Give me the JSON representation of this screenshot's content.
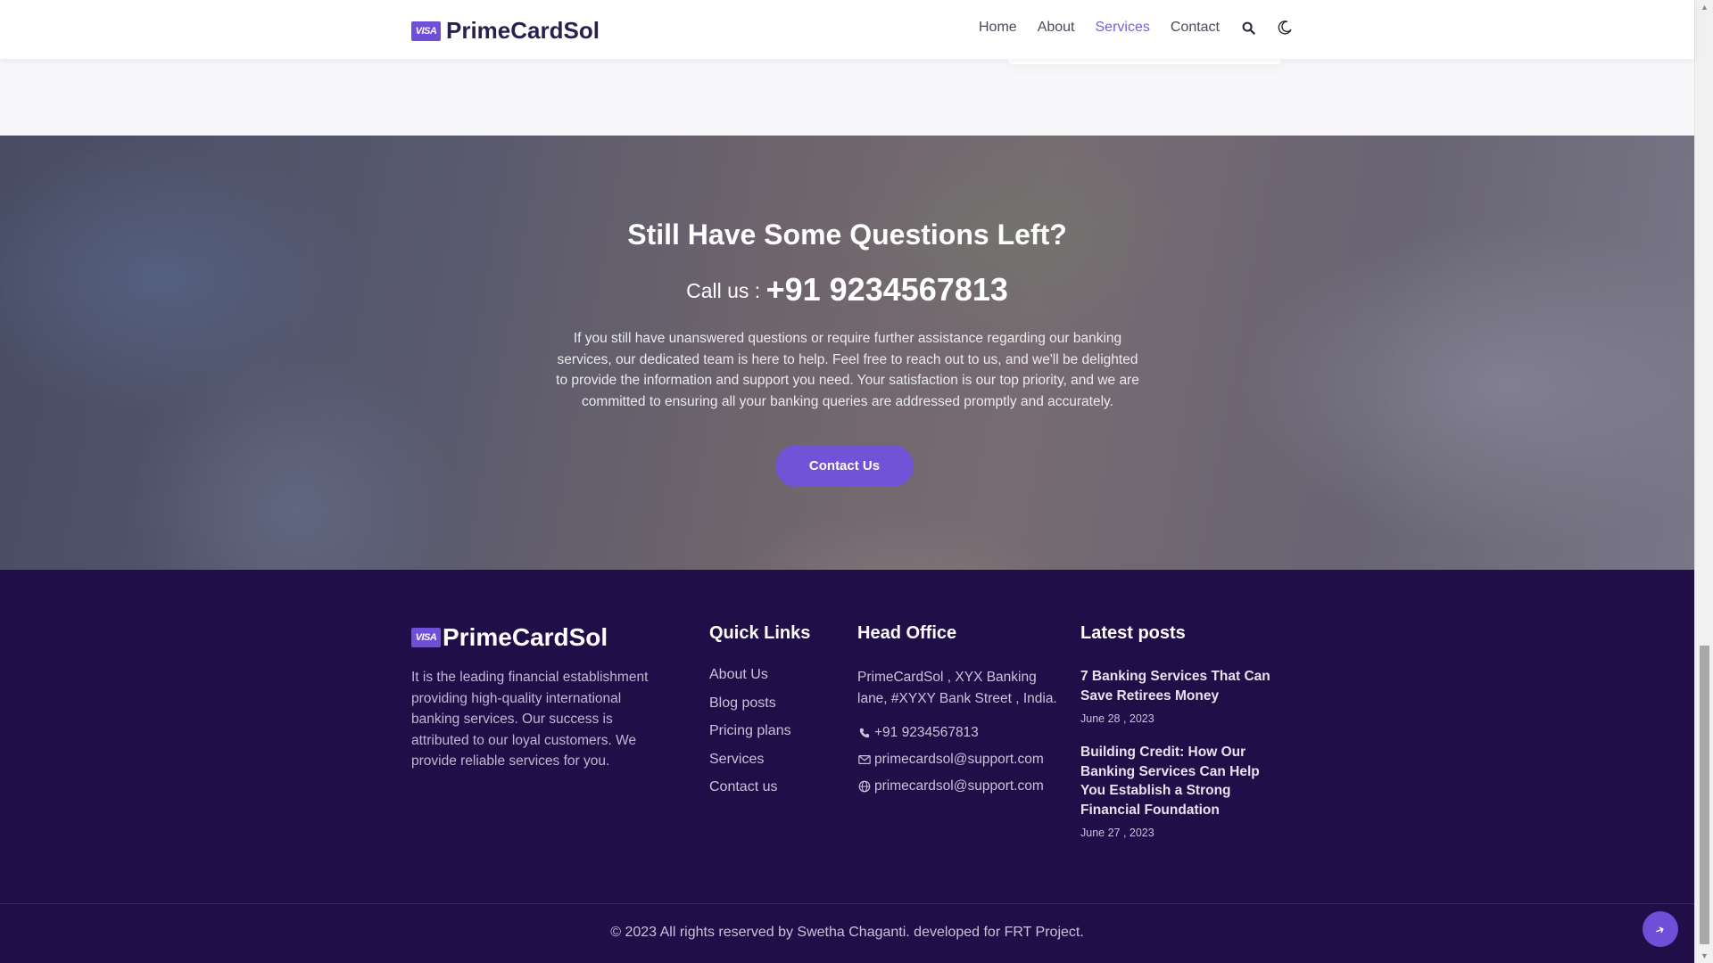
{
  "header": {
    "brand_badge": "VISA",
    "brand_name": "PrimeCardSol",
    "nav": [
      {
        "label": "Home"
      },
      {
        "label": "About"
      },
      {
        "label": "Services",
        "active": true
      },
      {
        "label": "Contact"
      }
    ],
    "icons": [
      "search-icon",
      "moon-icon"
    ]
  },
  "cta": {
    "title": "Still Have Some Questions Left?",
    "call_prefix": "Call us :",
    "phone": "+91 9234567813",
    "text": "If you still have unanswered questions or require further assistance regarding our banking services, our dedicated team is here to help. Feel free to reach out to us, and we'll be delighted to provide the information and support you need. Your satisfaction is our top priority, and we are committed to ensuring all your banking queries are addressed promptly and accurately.",
    "button": "Contact Us"
  },
  "footer": {
    "brand_badge": "VISA",
    "brand_name": "PrimeCardSol",
    "about": "It is the leading financial establishment providing high-quality international banking services. Our success is attributed to our loyal customers. We provide reliable services for you.",
    "quick_links": {
      "title": "Quick Links",
      "items": [
        "About Us",
        "Blog posts",
        "Pricing plans",
        "Services",
        "Contact us"
      ]
    },
    "head_office": {
      "title": "Head Office",
      "address": "PrimeCardSol , XYX Banking lane, #XYXY Bank Street , India.",
      "phone": "+91 9234567813",
      "email": "primecardsol@support.com",
      "website": "primecardsol@support.com"
    },
    "latest_posts": {
      "title": "Latest posts",
      "items": [
        {
          "title": "7 Banking Services That Can Save Retirees Money",
          "date": "June 28 , 2023"
        },
        {
          "title": "Building Credit: How Our Banking Services Can Help You Establish a Strong Financial Foundation",
          "date": "June 27 , 2023"
        }
      ]
    },
    "copyright": "© 2023 All rights reserved by Swetha Chaganti. developed for FRT Project."
  },
  "colors": {
    "accent": "#7053d6",
    "footer_bg": "#1f0e47",
    "brand_text": "#2a1f4d"
  }
}
